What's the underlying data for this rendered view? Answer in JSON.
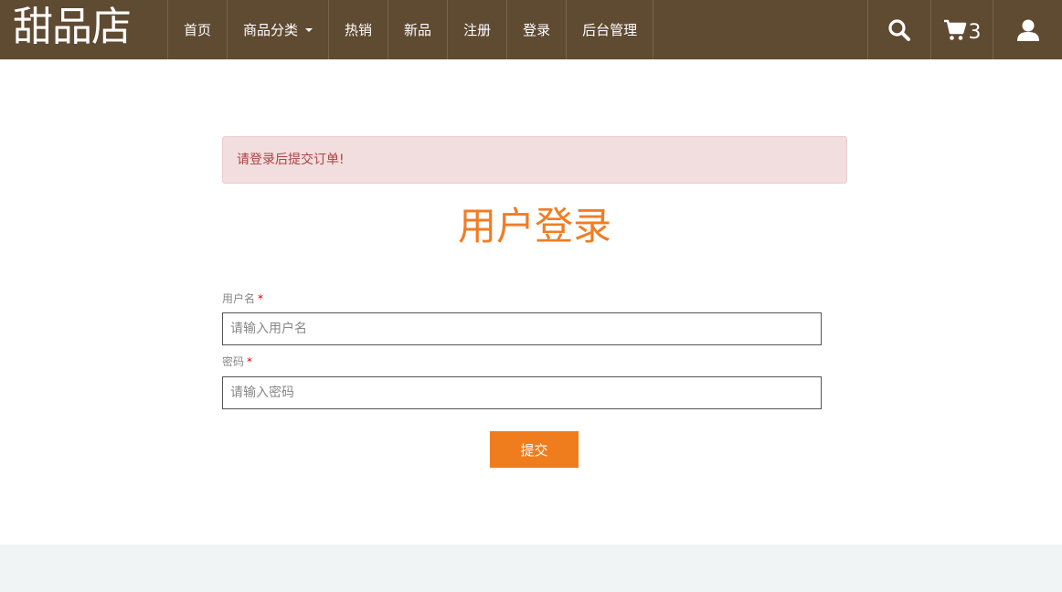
{
  "header": {
    "brand": "甜品店",
    "nav": [
      {
        "label": "首页"
      },
      {
        "label": "商品分类",
        "dropdown": true
      },
      {
        "label": "热销"
      },
      {
        "label": "新品"
      },
      {
        "label": "注册"
      },
      {
        "label": "登录"
      },
      {
        "label": "后台管理"
      }
    ],
    "icons": {
      "search": "search-icon",
      "cart": "cart-icon",
      "user": "user-icon"
    },
    "cart_count": "3"
  },
  "alert": {
    "message": "请登录后提交订单!"
  },
  "form": {
    "title": "用户登录",
    "username": {
      "label": "用户名",
      "required_mark": "*",
      "placeholder": "请输入用户名",
      "value": ""
    },
    "password": {
      "label": "密码",
      "required_mark": "*",
      "placeholder": "请输入密码",
      "value": ""
    },
    "submit_label": "提交"
  },
  "colors": {
    "navbar": "#5f4a32",
    "accent": "#f07d1d",
    "alert_bg": "#f2dede",
    "alert_text": "#a94442"
  }
}
